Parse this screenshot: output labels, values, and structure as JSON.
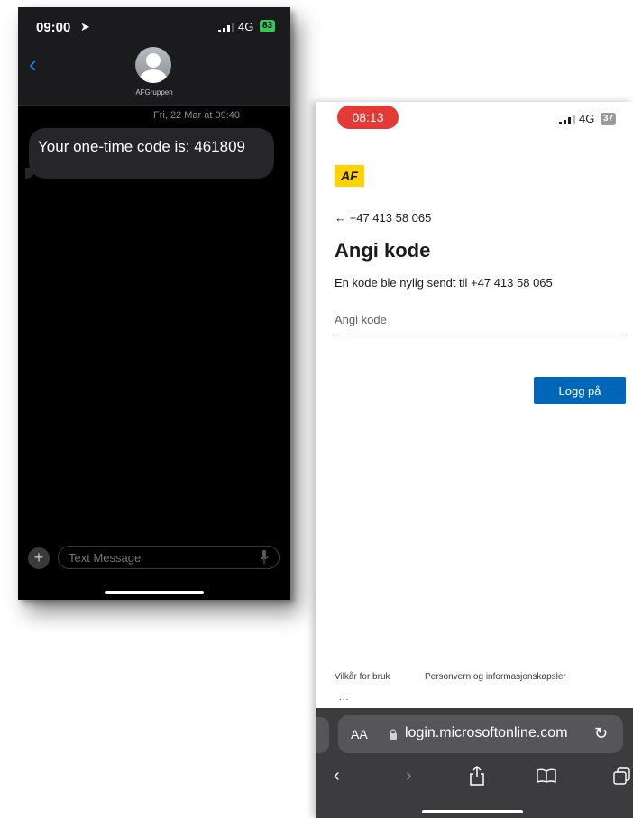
{
  "left_phone": {
    "status": {
      "time": "09:00",
      "network": "4G",
      "battery": "83"
    },
    "contact": {
      "name": "AFGruppen"
    },
    "message": {
      "date": "Fri, 22 Mar at 09:40",
      "text": "Your one-time code is: 461809"
    },
    "composer": {
      "placeholder": "Text Message"
    },
    "colors": {
      "accent": "#0a84ff",
      "battery": "#35c759"
    }
  },
  "right_phone": {
    "status": {
      "time": "08:13",
      "network": "4G",
      "battery": "37"
    },
    "logo": {
      "text": "AF"
    },
    "back": {
      "arrow": "←",
      "phone": "+47 413 58 065"
    },
    "title": "Angi kode",
    "description": "En kode ble nylig sendt til +47 413 58 065",
    "code_input": {
      "placeholder": "Angi kode",
      "value": ""
    },
    "submit_label": "Logg på",
    "footer": {
      "terms": "Vilkår for bruk",
      "privacy": "Personvern og informasjonskapsler",
      "more": "..."
    },
    "browser": {
      "aa": "AA",
      "url": "login.microsoftonline.com"
    },
    "colors": {
      "primary": "#0067b8",
      "status_time_bg": "#e53935",
      "logo_bg": "#ffd200"
    }
  }
}
